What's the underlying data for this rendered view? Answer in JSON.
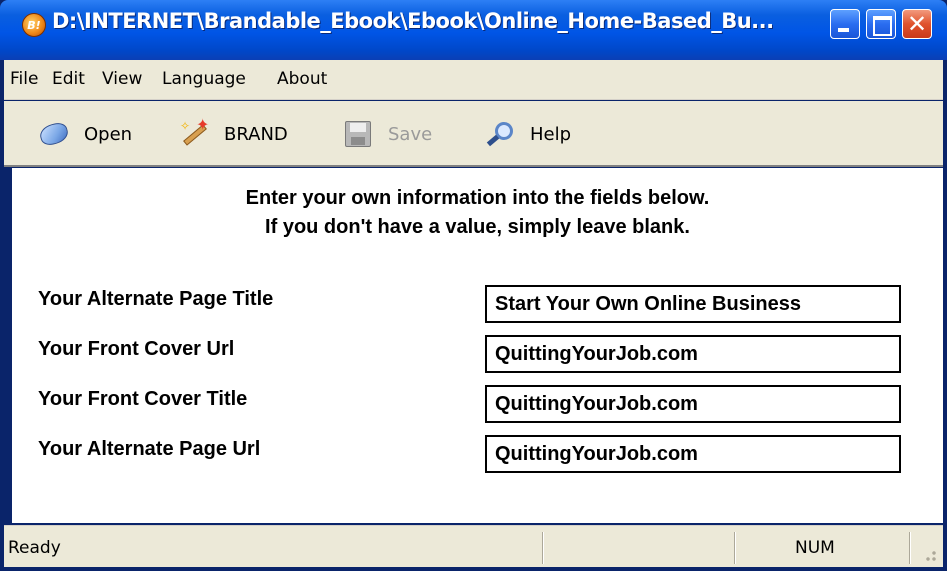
{
  "window": {
    "title": "D:\\INTERNET\\Brandable_Ebook\\Ebook\\Online_Home-Based_Bu...",
    "icon_glyph": "B!",
    "close_glyph": "✕",
    "accent_color": "#0055e6"
  },
  "menu": {
    "items": [
      {
        "label": "File"
      },
      {
        "label": "Edit"
      },
      {
        "label": "View"
      },
      {
        "label": "Language"
      },
      {
        "label": "About"
      }
    ]
  },
  "toolbar": {
    "buttons": [
      {
        "label": "Open",
        "icon": "open-folder-icon",
        "enabled": true
      },
      {
        "label": "BRAND",
        "icon": "magic-wand-icon",
        "enabled": true
      },
      {
        "label": "Save",
        "icon": "floppy-disk-icon",
        "enabled": false
      },
      {
        "label": "Help",
        "icon": "magnifier-icon",
        "enabled": true
      }
    ]
  },
  "form": {
    "instruction_line1": "Enter your own information into the fields below.",
    "instruction_line2": "If you don't have a value, simply leave blank.",
    "fields": [
      {
        "label": "Your Alternate Page Title",
        "value": "Start Your Own Online Business"
      },
      {
        "label": "Your Front Cover Url",
        "value": "QuittingYourJob.com"
      },
      {
        "label": "Your Front Cover Title",
        "value": "QuittingYourJob.com"
      },
      {
        "label": "Your Alternate Page Url",
        "value": "QuittingYourJob.com"
      }
    ]
  },
  "status": {
    "text": "Ready",
    "num": "NUM"
  }
}
